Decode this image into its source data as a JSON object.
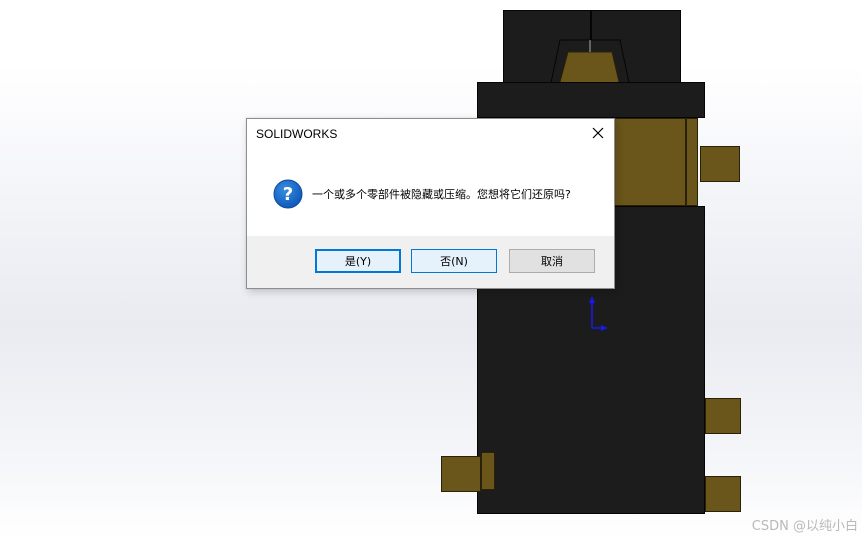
{
  "dialog": {
    "title": "SOLIDWORKS",
    "message": "一个或多个零部件被隐藏或压缩。您想将它们还原吗?",
    "icon": "question-icon",
    "buttons": {
      "yes": "是(Y)",
      "no": "否(N)",
      "cancel": "取消"
    }
  },
  "watermark": "CSDN @以纯小白",
  "colors": {
    "part_black": "#1c1c1c",
    "part_gold": "#6a561a",
    "accent": "#0078d7",
    "triad_blue": "#1a1ae6"
  }
}
